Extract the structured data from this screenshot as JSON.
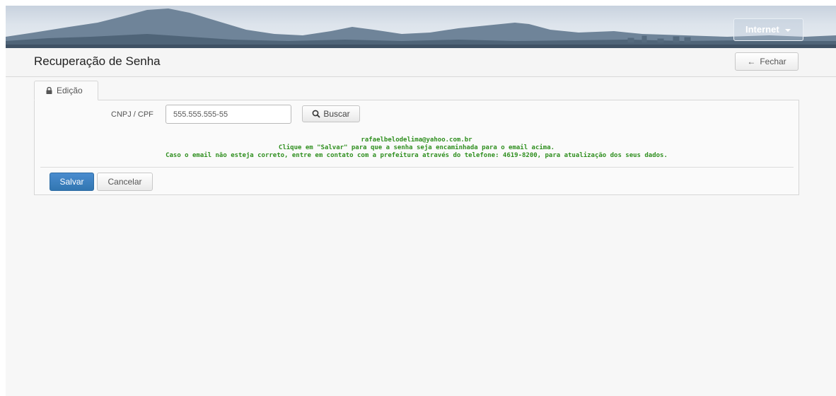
{
  "header": {
    "network_menu_label": "Internet"
  },
  "title_bar": {
    "title": "Recuperação de Senha",
    "close_label": "Fechar"
  },
  "tabs": [
    {
      "label": "Edição",
      "icon": "lock-icon",
      "active": true
    }
  ],
  "form": {
    "document_label": "CNPJ / CPF",
    "document_value": "555.555.555-55",
    "search_label": "Buscar"
  },
  "message": {
    "email": "rafaelbelodelima@yahoo.com.br",
    "line1": "Clique em \"Salvar\" para que a senha seja encaminhada para o email acima.",
    "line2": "Caso o email não esteja correto, entre em contato com a prefeitura através do telefone: 4619-8200, para atualização dos seus dados.",
    "color": "#2f8f1f"
  },
  "actions": {
    "save_label": "Salvar",
    "cancel_label": "Cancelar"
  },
  "colors": {
    "primary_button": "#3276b1",
    "page_background": "#f7f7f7"
  }
}
